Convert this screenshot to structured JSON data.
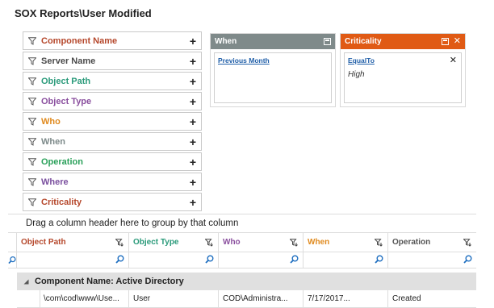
{
  "page": {
    "title": "SOX Reports\\User Modified"
  },
  "filters": [
    {
      "label": "Component Name",
      "color": "#b5472b"
    },
    {
      "label": "Server Name",
      "color": "#4a4a4a"
    },
    {
      "label": "Object Path",
      "color": "#2a9a7a"
    },
    {
      "label": "Object Type",
      "color": "#8a4f9e"
    },
    {
      "label": "Who",
      "color": "#e08a1e"
    },
    {
      "label": "When",
      "color": "#7d8a8a"
    },
    {
      "label": "Operation",
      "color": "#2aa05a"
    },
    {
      "label": "Where",
      "color": "#7a4f9e"
    },
    {
      "label": "Criticality",
      "color": "#b5472b"
    }
  ],
  "panels": {
    "when": {
      "title": "When",
      "link": "Previous Month",
      "header_color": "#7f8a8a"
    },
    "criticality": {
      "title": "Criticality",
      "link": "EqualTo",
      "value": "High",
      "header_color": "#e05a14"
    }
  },
  "grid": {
    "group_hint": "Drag a column header here to group by that column",
    "columns": [
      {
        "label": "Object Path",
        "color": "#b5472b"
      },
      {
        "label": "Object Type",
        "color": "#2a9a7a"
      },
      {
        "label": "Who",
        "color": "#8a4f9e"
      },
      {
        "label": "When",
        "color": "#e08a1e"
      },
      {
        "label": "Operation",
        "color": "#555555"
      }
    ],
    "group_label": "Component Name: Active Directory",
    "rows": [
      {
        "object_path": "\\com\\cod\\www\\Use...",
        "object_type": "User",
        "who": "COD\\Administra...",
        "when": "7/17/2017...",
        "operation": "Created"
      }
    ]
  },
  "icons": {
    "filter": "funnel-icon",
    "add": "plus-icon",
    "search": "magnifier-icon",
    "collapse": "triangle-icon"
  }
}
